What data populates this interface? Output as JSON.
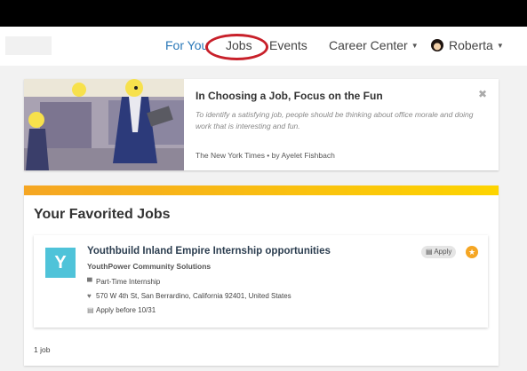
{
  "nav": {
    "for_you": "For You",
    "jobs": "Jobs",
    "events": "Events",
    "career_center": "Career Center",
    "user_name": "Roberta"
  },
  "article": {
    "title": "In Choosing a Job, Focus on the Fun",
    "description": "To identify a satisfying job, people should be thinking about office morale and doing work that is interesting and fun.",
    "source": "The New York Times • by Ayelet Fishbach"
  },
  "favorites": {
    "heading": "Your Favorited Jobs",
    "count_label": "1 job",
    "jobs": [
      {
        "logo_letter": "Y",
        "title": "Youthbuild Inland Empire Internship opportunities",
        "company": "YouthPower Community Solutions",
        "type": "Part-Time Internship",
        "location": "570 W 4th St, San Berrardino, California 92401, United States",
        "deadline": "Apply before 10/31",
        "apply_label": "Apply"
      }
    ]
  },
  "colors": {
    "accent_blue": "#2a78b8",
    "highlight_red": "#c8202a",
    "logo_teal": "#4fc3d9",
    "star_orange": "#f5a623"
  },
  "icons": [
    "chevron-down-icon",
    "close-icon",
    "briefcase-icon",
    "map-pin-icon",
    "document-icon",
    "star-icon"
  ]
}
